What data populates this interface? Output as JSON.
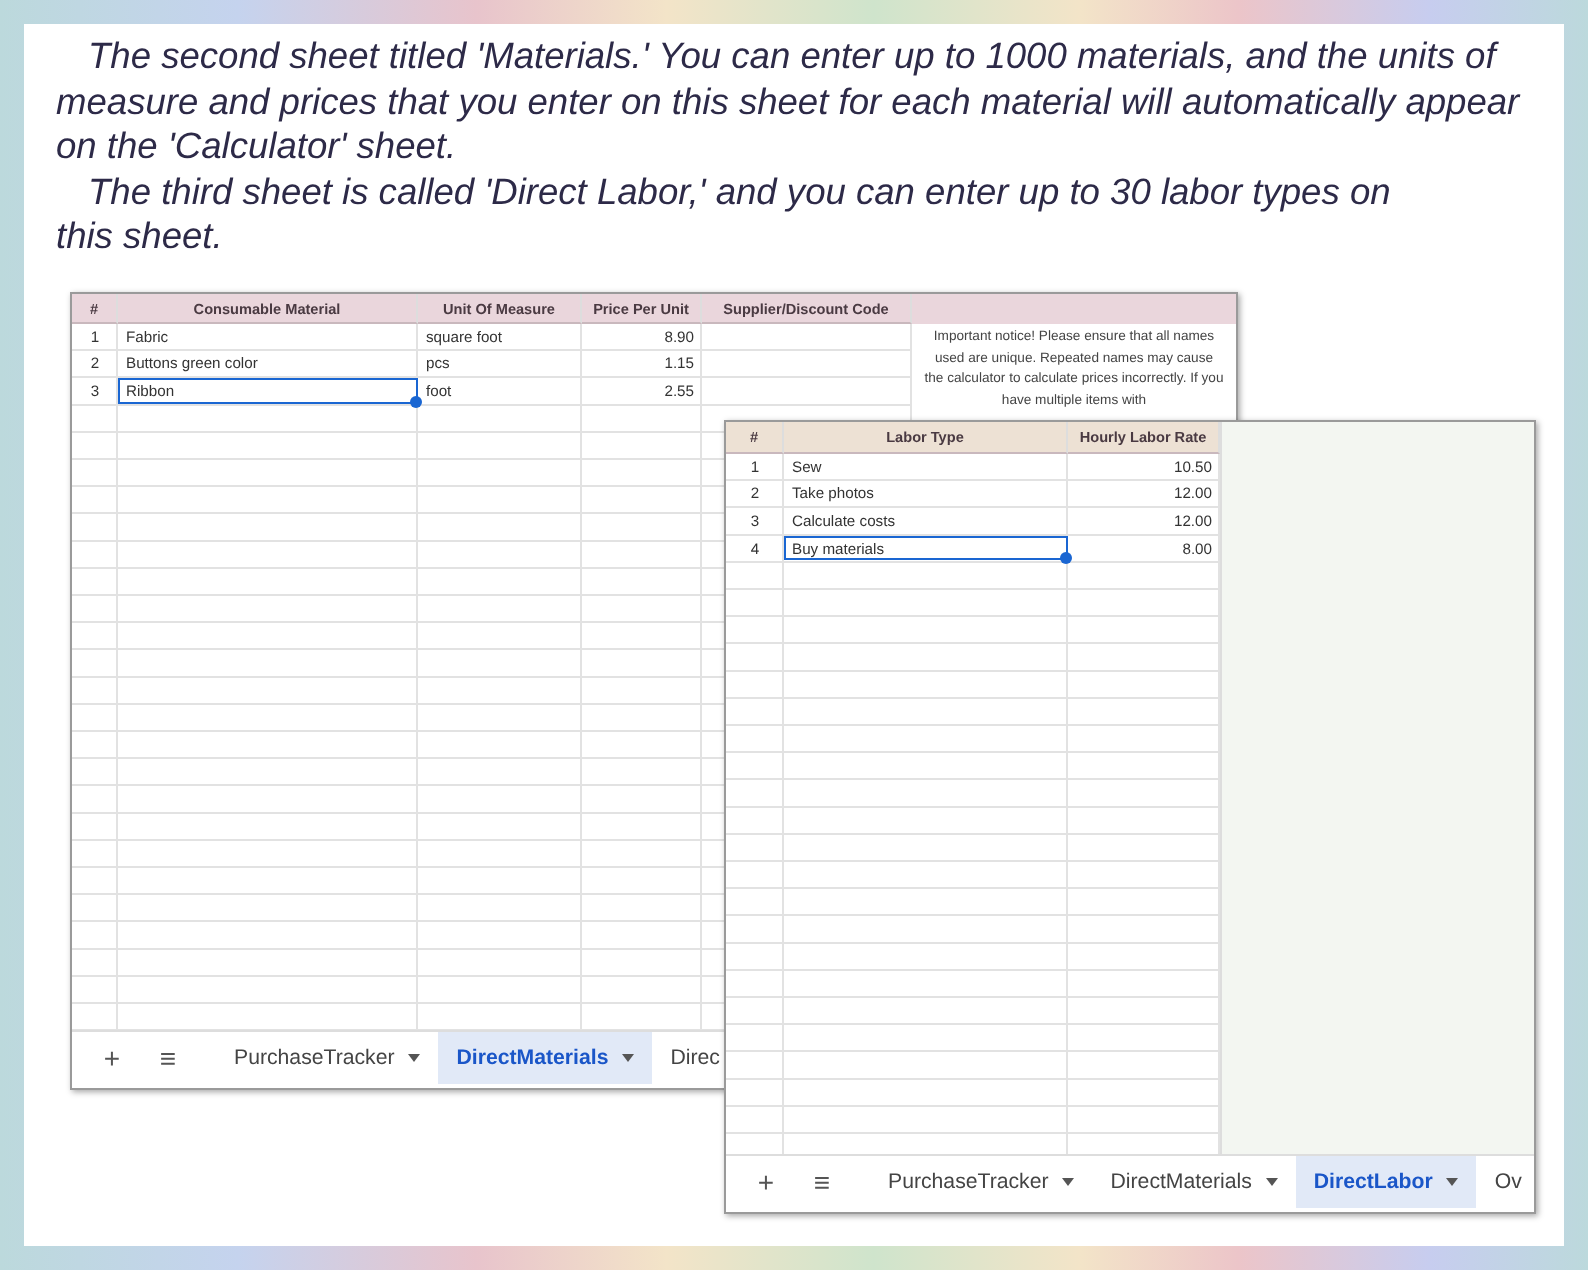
{
  "intro": [
    "The second sheet titled 'Materials.' You can enter up to 1000 materials, and the units of measure and prices that you enter on this sheet for each material will automatically appear on the 'Calculator' sheet.",
    "The third sheet is called 'Direct Labor,' and you can enter up to 30 labor types on this sheet."
  ],
  "materials_sheet": {
    "columns": [
      "#",
      "Consumable Material",
      "Unit Of Measure",
      "Price Per Unit",
      "Supplier/Discount Code"
    ],
    "rows": [
      {
        "number": "1",
        "material": "Fabric",
        "unit": "square foot",
        "price": "8.90",
        "selected": false
      },
      {
        "number": "2",
        "material": "Buttons green color",
        "unit": "pcs",
        "price": "1.15",
        "selected": false
      },
      {
        "number": "3",
        "material": "Ribbon",
        "unit": "foot",
        "price": "2.55",
        "selected": true
      }
    ],
    "notice": "Important notice! Please ensure that all names used are unique. Repeated names may cause the calculator to calculate prices incorrectly. If you have multiple items with",
    "add_tab": "+",
    "menu": "≡",
    "tabs": [
      {
        "label": "PurchaseTracker",
        "selected": false,
        "caret": true
      },
      {
        "label": "DirectMaterials",
        "selected": true,
        "caret": true
      },
      {
        "label": "Direc",
        "selected": false,
        "caret": false
      }
    ]
  },
  "labor_sheet": {
    "columns": [
      "#",
      "Labor Type",
      "Hourly Labor Rate"
    ],
    "rows": [
      {
        "number": "1",
        "labor": "Sew",
        "rate": "10.50",
        "selected": false
      },
      {
        "number": "2",
        "labor": "Take photos",
        "rate": "12.00",
        "selected": false
      },
      {
        "number": "3",
        "labor": "Calculate costs",
        "rate": "12.00",
        "selected": false
      },
      {
        "number": "4",
        "labor": "Buy materials",
        "rate": "8.00",
        "selected": true
      }
    ],
    "add_tab": "+",
    "menu": "≡",
    "tabs": [
      {
        "label": "PurchaseTracker",
        "selected": false,
        "caret": true
      },
      {
        "label": "DirectMaterials",
        "selected": false,
        "caret": true
      },
      {
        "label": "DirectLabor",
        "selected": true,
        "caret": true
      },
      {
        "label": "Ov",
        "selected": false,
        "caret": false
      }
    ]
  }
}
